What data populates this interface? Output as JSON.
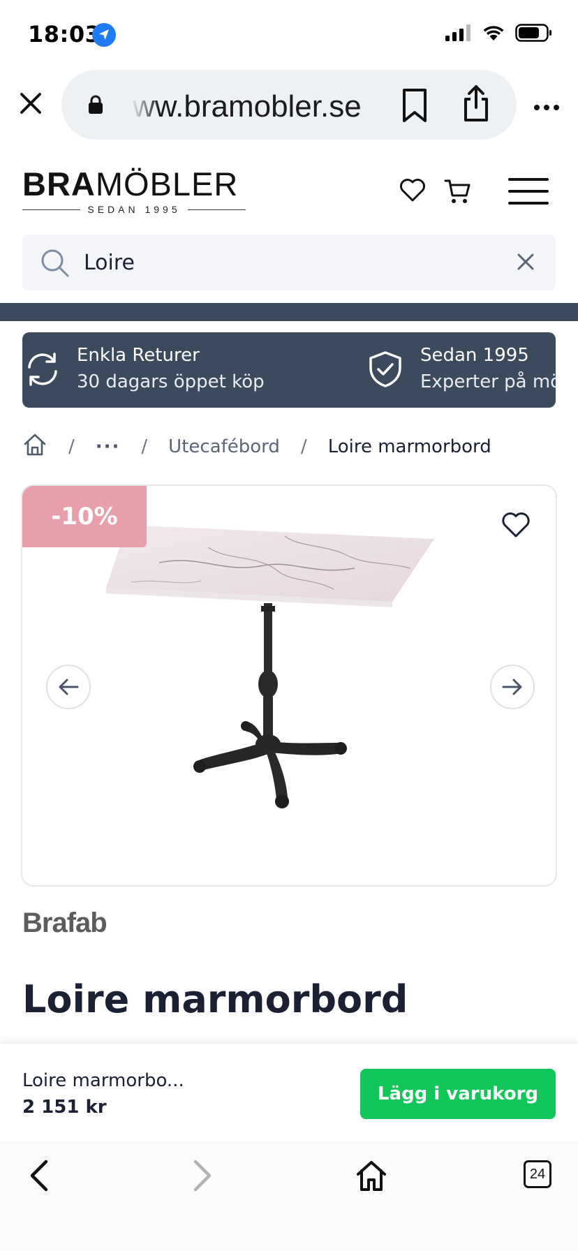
{
  "status_bar": {
    "time": "18:03"
  },
  "browser": {
    "url": "ww.bramobler.se",
    "tab_count": "24"
  },
  "site": {
    "logo_bold": "BRA",
    "logo_light": "MÖBLER",
    "logo_tagline": "SEDAN 1995"
  },
  "search": {
    "value": "Loire"
  },
  "usp": [
    {
      "title": "Enkla Returer",
      "subtitle": "30 dagars öppet köp"
    },
    {
      "title": "Sedan 1995",
      "subtitle": "Experter på möbler"
    }
  ],
  "breadcrumb": {
    "ellipsis": "···",
    "category": "Utecafébord",
    "current": "Loire marmorbord",
    "separator": "/"
  },
  "product": {
    "discount": "-10%",
    "brand": "Brafab",
    "title": "Loire marmorbord"
  },
  "sticky": {
    "name": "Loire marmorbo...",
    "price": "2 151 kr",
    "add_label": "Lägg i varukorg"
  },
  "colors": {
    "header_dark": "#3c4a5e",
    "discount": "#e79fac",
    "cta_green": "#12c65a",
    "ios_blue": "#1f7cf5"
  }
}
